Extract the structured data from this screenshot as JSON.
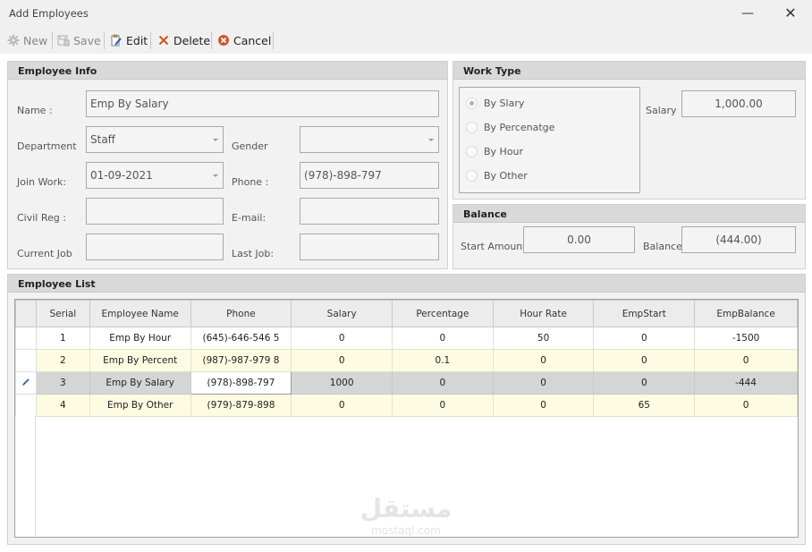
{
  "window": {
    "title": "Add Employees",
    "minimize_glyph": "—",
    "close_glyph": "✕"
  },
  "toolbar": {
    "new_label": "New",
    "save_label": "Save",
    "edit_label": "Edit",
    "delete_label": "Delete",
    "cancel_label": "Cancel"
  },
  "employee_info": {
    "heading": "Employee Info",
    "name_label": "Name :",
    "name_value": "Emp By Salary",
    "department_label": "Department",
    "department_value": "Staff",
    "gender_label": "Gender",
    "gender_value": "",
    "join_label": "Join Work:",
    "join_value": "01-09-2021",
    "phone_label": "Phone :",
    "phone_value": "(978)-898-797",
    "civil_label": "Civil Reg :",
    "civil_value": "",
    "email_label": "E-mail:",
    "email_value": "",
    "current_job_label": "Current Job",
    "current_job_value": "",
    "last_job_label": "Last Job:",
    "last_job_value": ""
  },
  "work_type": {
    "heading": "Work Type",
    "options": [
      "By Slary",
      "By Percenatge",
      "By Hour",
      "By Other"
    ],
    "selected": "By Slary",
    "salary_label": "Salary",
    "salary_value": "1,000.00"
  },
  "balance": {
    "heading": "Balance",
    "start_label": "Start Amount",
    "start_value": "0.00",
    "balance_label": "Balance",
    "balance_value": "(444.00)"
  },
  "employee_list": {
    "heading": "Employee List",
    "columns": [
      "Serial",
      "Employee Name",
      "Phone",
      "Salary",
      "Percentage",
      "Hour Rate",
      "EmpStart",
      "EmpBalance"
    ],
    "rows": [
      [
        "1",
        "Emp By Hour",
        "(645)-646-546 5",
        "0",
        "0",
        "50",
        "0",
        "-1500"
      ],
      [
        "2",
        "Emp By Percent",
        "(987)-987-979 8",
        "0",
        "0.1",
        "0",
        "0",
        "0"
      ],
      [
        "3",
        "Emp By Salary",
        "(978)-898-797",
        "1000",
        "0",
        "0",
        "0",
        "-444"
      ],
      [
        "4",
        "Emp By Other",
        "(979)-879-898",
        "0",
        "0",
        "0",
        "65",
        "0"
      ]
    ],
    "selected_row": 2
  },
  "watermark": {
    "main": "مستقل",
    "sub": "mostaql.com"
  },
  "colors": {
    "header_bg": "#d9d9d9",
    "row_alt": "#fdfbe1",
    "row_selected": "#d5d5d5",
    "edit_pencil": "#2a5a9a"
  }
}
